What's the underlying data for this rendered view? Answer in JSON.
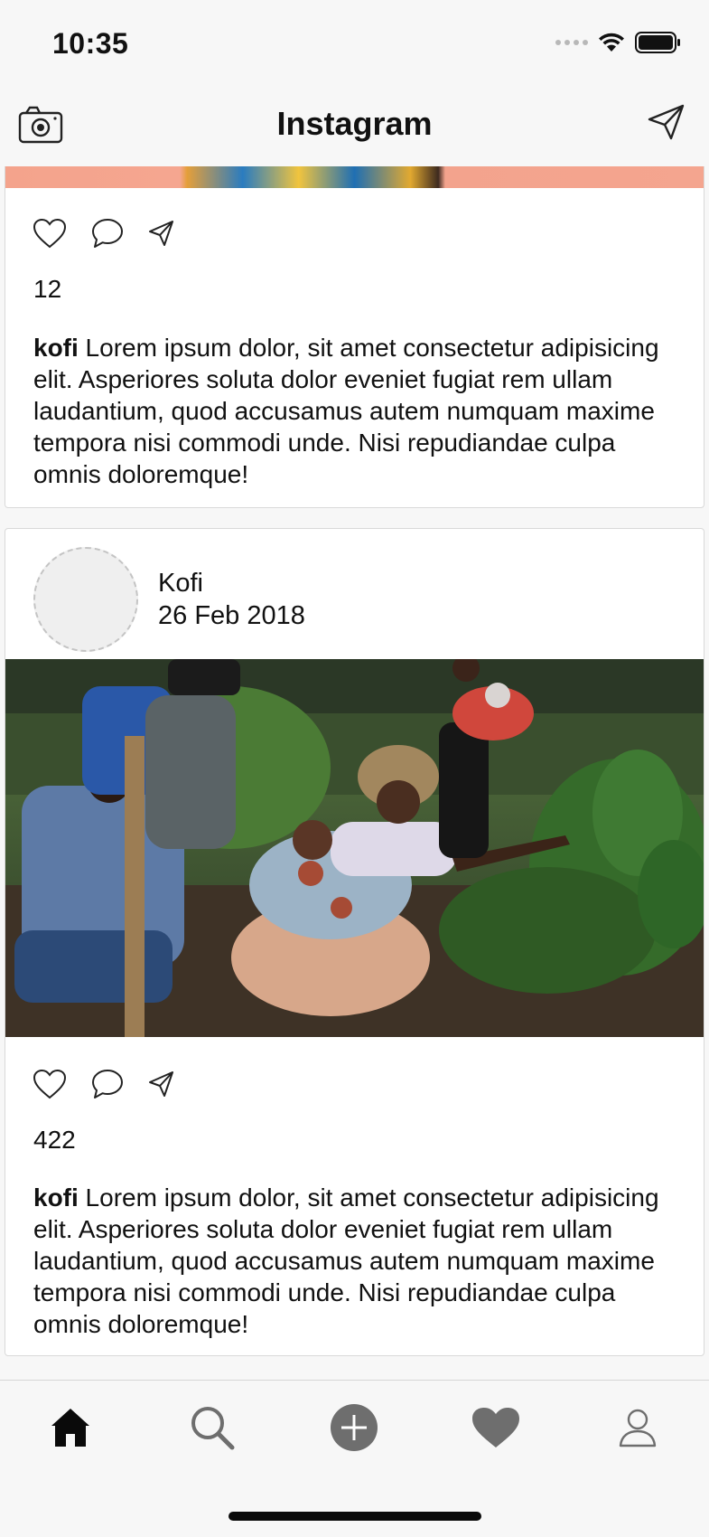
{
  "status_bar": {
    "time": "10:35"
  },
  "nav": {
    "title": "Instagram",
    "camera_icon": "camera-icon",
    "send_icon": "paper-plane-icon"
  },
  "posts": [
    {
      "likes": "12",
      "caption_user": "kofi",
      "caption_text": " Lorem ipsum dolor, sit amet consectetur adipisicing elit. Asperiores soluta dolor eveniet fugiat rem ullam laudantium, quod accusamus autem numquam maxime tempora nisi commodi unde. Nisi repudiandae culpa omnis doloremque!"
    },
    {
      "user": "Kofi",
      "date": "26 Feb 2018",
      "likes": "422",
      "caption_user": "kofi",
      "caption_text": " Lorem ipsum dolor, sit amet consectetur adipisicing elit. Asperiores soluta dolor eveniet fugiat rem ullam laudantium, quod accusamus autem numquam maxime tempora nisi commodi unde. Nisi repudiandae culpa omnis doloremque!"
    }
  ],
  "tabs": [
    "home-icon",
    "search-icon",
    "add-icon",
    "heart-icon",
    "profile-icon"
  ],
  "colors": {
    "background": "#f7f7f7",
    "card": "#ffffff",
    "icon": "#222222",
    "inactive_icon": "#6e6e6e"
  }
}
